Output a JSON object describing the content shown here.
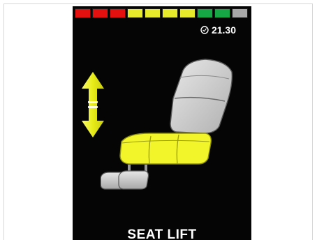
{
  "battery": {
    "segments": [
      "red",
      "red",
      "red",
      "yellow",
      "yellow",
      "yellow",
      "yellow",
      "green",
      "green",
      "gray"
    ],
    "colors": {
      "red": "#e41010",
      "yellow": "#e6ea2a",
      "green": "#16a845",
      "gray": "#a8a8a8"
    }
  },
  "status": {
    "timer_icon": "clock-icon",
    "timer_value": "21.30"
  },
  "direction_icon": "up-down-arrow-icon",
  "seat_highlight_color": "#f1f52a",
  "mode_label": "SEAT LIFT"
}
